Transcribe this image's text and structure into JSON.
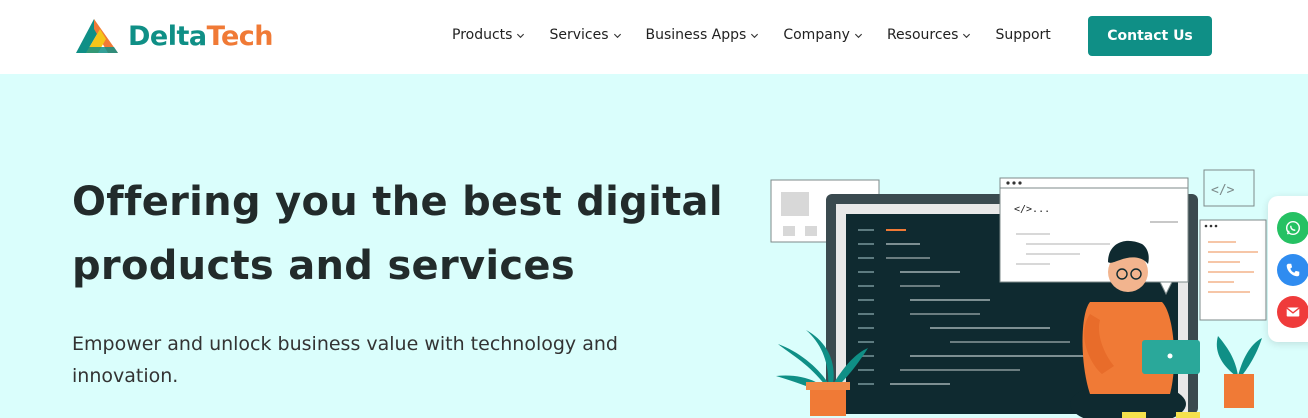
{
  "brand": {
    "name_part1": "Delta",
    "name_part2": "Tech",
    "colors": {
      "teal": "#0f8f86",
      "orange": "#f07a36",
      "yellow": "#f5c518"
    }
  },
  "nav": {
    "items": [
      {
        "label": "Products",
        "has_dropdown": true
      },
      {
        "label": "Services",
        "has_dropdown": true
      },
      {
        "label": "Business Apps",
        "has_dropdown": true
      },
      {
        "label": "Company",
        "has_dropdown": true
      },
      {
        "label": "Resources",
        "has_dropdown": true
      },
      {
        "label": "Support",
        "has_dropdown": false
      }
    ],
    "cta_label": "Contact Us"
  },
  "hero": {
    "title_line1": "Offering you the best digital",
    "title_line2": "products and services",
    "subtitle_line1": "Empower and unlock business value with technology and",
    "subtitle_line2": "innovation.",
    "background": "#dafefc",
    "code_snippet": "</>...",
    "code_icon": "</>"
  },
  "floating_contacts": [
    {
      "icon": "whatsapp-icon",
      "color": "#25c163"
    },
    {
      "icon": "phone-icon",
      "color": "#2f8cf0"
    },
    {
      "icon": "mail-icon",
      "color": "#ef3b3b"
    }
  ]
}
